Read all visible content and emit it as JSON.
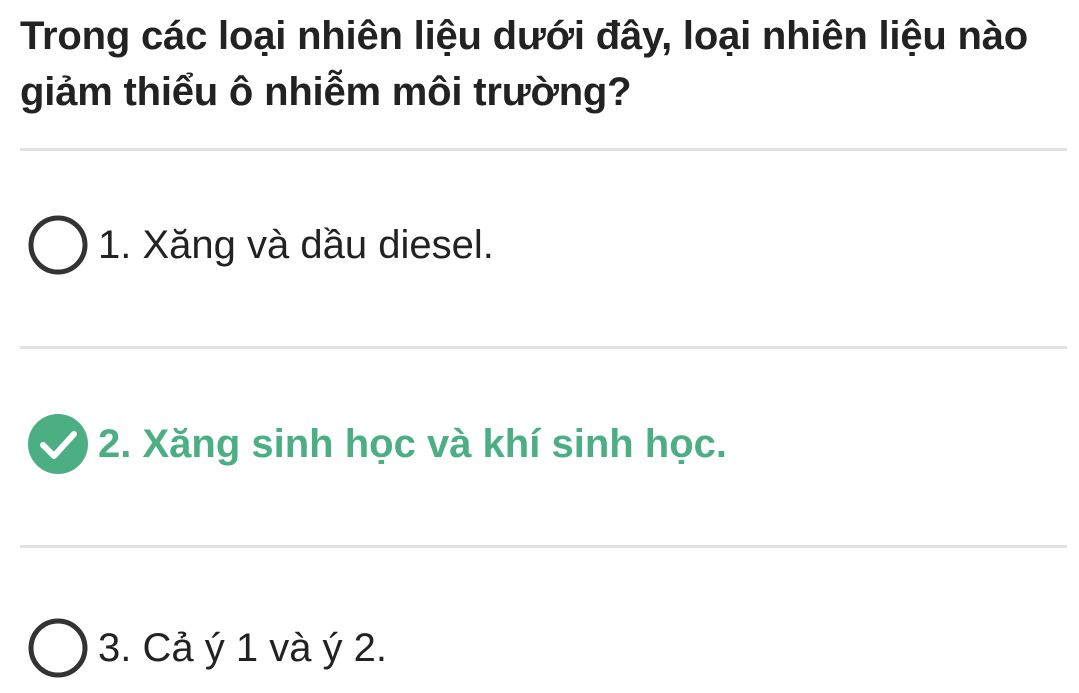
{
  "question": {
    "text": "Trong các loại nhiên liệu dưới đây, loại nhiên liệu nào giảm thiểu ô nhiễm môi trường?"
  },
  "options": [
    {
      "label": "1. Xăng và dầu diesel.",
      "selected": false,
      "icon": "radio-empty-icon"
    },
    {
      "label": "2. Xăng sinh học và khí sinh học.",
      "selected": true,
      "icon": "check-circle-icon"
    },
    {
      "label": "3. Cả ý 1 và ý 2.",
      "selected": false,
      "icon": "radio-empty-icon"
    }
  ],
  "colors": {
    "text": "#222222",
    "correct": "#4caf84",
    "radio_border": "#333333",
    "divider": "#e2e2e2"
  }
}
